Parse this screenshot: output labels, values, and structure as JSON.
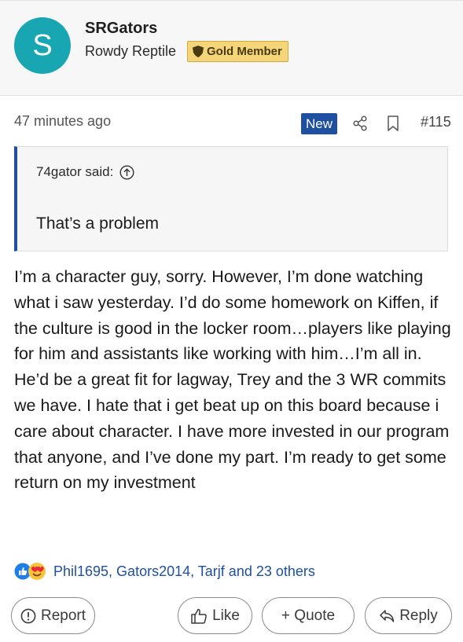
{
  "user": {
    "avatar_letter": "S",
    "avatar_color": "#19a6b3",
    "username": "SRGators",
    "title": "Rowdy Reptile",
    "badge": "Gold Member"
  },
  "meta": {
    "timestamp": "47 minutes ago",
    "new_label": "New",
    "post_number": "#115",
    "share_icon": "share-icon",
    "bookmark_icon": "bookmark-icon"
  },
  "quote": {
    "author": "74gator said:",
    "text": "That’s a problem"
  },
  "post": {
    "body": "I’m a character guy, sorry. However, I’m done watching what i saw yesterday. I’d do some homework on Kiffen, if the culture is good in the locker room…players like playing for him and assistants like working with him…I’m all in. He’d be a great fit for lagway, Trey and the 3 WR commits we have. I hate that i get beat up on this board because i care about character. I have more invested in our program that anyone, and I’ve done my part. I’m ready to get some return on my investment"
  },
  "reactions": {
    "summary": "Phil1695, Gators2014, Tarjf and 23 others",
    "icons": [
      "like-reaction-icon",
      "love-reaction-icon"
    ]
  },
  "actions": {
    "report": "Report",
    "like": "Like",
    "quote": "+ Quote",
    "reply": "Reply"
  },
  "colors": {
    "accent": "#1f4fa0",
    "badge_bg": "#f5d57a"
  }
}
